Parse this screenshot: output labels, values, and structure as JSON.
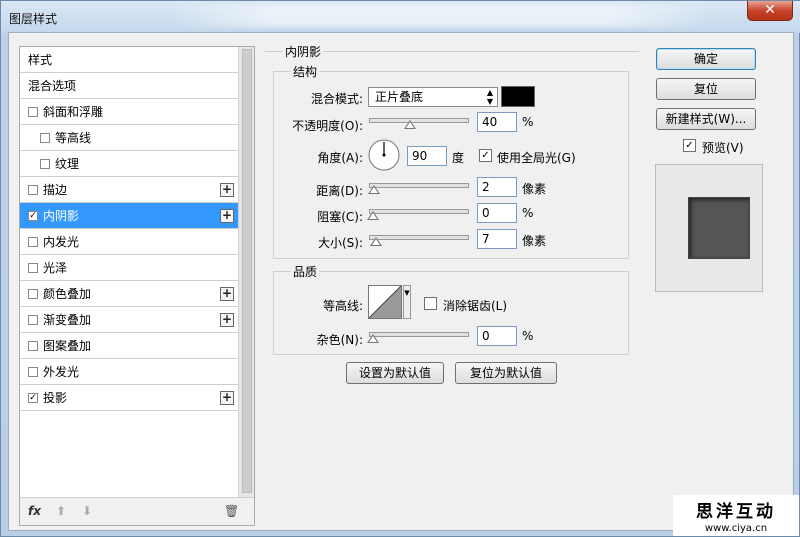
{
  "window": {
    "title": "图层样式",
    "close_icon": "close-icon"
  },
  "styles": {
    "items": [
      {
        "label": "样式",
        "checkbox": false,
        "checked": false,
        "indent": false,
        "plus": false,
        "selected": false
      },
      {
        "label": "混合选项",
        "checkbox": false,
        "checked": false,
        "indent": false,
        "plus": false,
        "selected": false
      },
      {
        "label": "斜面和浮雕",
        "checkbox": true,
        "checked": false,
        "indent": false,
        "plus": false,
        "selected": false
      },
      {
        "label": "等高线",
        "checkbox": true,
        "checked": false,
        "indent": true,
        "plus": false,
        "selected": false
      },
      {
        "label": "纹理",
        "checkbox": true,
        "checked": false,
        "indent": true,
        "plus": false,
        "selected": false
      },
      {
        "label": "描边",
        "checkbox": true,
        "checked": false,
        "indent": false,
        "plus": true,
        "selected": false
      },
      {
        "label": "内阴影",
        "checkbox": true,
        "checked": true,
        "indent": false,
        "plus": true,
        "selected": true
      },
      {
        "label": "内发光",
        "checkbox": true,
        "checked": false,
        "indent": false,
        "plus": false,
        "selected": false
      },
      {
        "label": "光泽",
        "checkbox": true,
        "checked": false,
        "indent": false,
        "plus": false,
        "selected": false
      },
      {
        "label": "颜色叠加",
        "checkbox": true,
        "checked": false,
        "indent": false,
        "plus": true,
        "selected": false
      },
      {
        "label": "渐变叠加",
        "checkbox": true,
        "checked": false,
        "indent": false,
        "plus": true,
        "selected": false
      },
      {
        "label": "图案叠加",
        "checkbox": true,
        "checked": false,
        "indent": false,
        "plus": false,
        "selected": false
      },
      {
        "label": "外发光",
        "checkbox": true,
        "checked": false,
        "indent": false,
        "plus": false,
        "selected": false
      },
      {
        "label": "投影",
        "checkbox": true,
        "checked": true,
        "indent": false,
        "plus": true,
        "selected": false
      }
    ],
    "footer": {
      "fx": "fx",
      "up_icon": "arrow-up-icon",
      "down_icon": "arrow-down-icon",
      "trash_icon": "trash-icon"
    }
  },
  "inner_shadow": {
    "section_title": "内阴影",
    "structure": {
      "title": "结构",
      "blend_mode_label": "混合模式:",
      "blend_mode_value": "正片叠底",
      "shadow_color": "#000000",
      "opacity_label": "不透明度(O):",
      "opacity_value": "40",
      "opacity_unit": "%",
      "opacity_level": 0.4,
      "angle_label": "角度(A):",
      "angle_value": "90",
      "angle_unit": "度",
      "global_light_label": "使用全局光(G)",
      "global_light_checked": true,
      "distance_label": "距离(D):",
      "distance_value": "2",
      "distance_unit": "像素",
      "distance_level": 0.01,
      "choke_label": "阻塞(C):",
      "choke_value": "0",
      "choke_unit": "%",
      "choke_level": 0.0,
      "size_label": "大小(S):",
      "size_value": "7",
      "size_unit": "像素",
      "size_level": 0.03
    },
    "quality": {
      "title": "品质",
      "contour_label": "等高线:",
      "anti_alias_label": "消除锯齿(L)",
      "anti_alias_checked": false,
      "noise_label": "杂色(N):",
      "noise_value": "0",
      "noise_unit": "%",
      "noise_level": 0.0
    },
    "buttons": {
      "make_default": "设置为默认值",
      "reset_default": "复位为默认值"
    }
  },
  "side_buttons": {
    "ok": "确定",
    "reset": "复位",
    "new_style": "新建样式(W)...",
    "preview_label": "预览(V)",
    "preview_checked": true
  },
  "watermark": {
    "title": "思洋互动",
    "url": "www.ciya.cn"
  }
}
